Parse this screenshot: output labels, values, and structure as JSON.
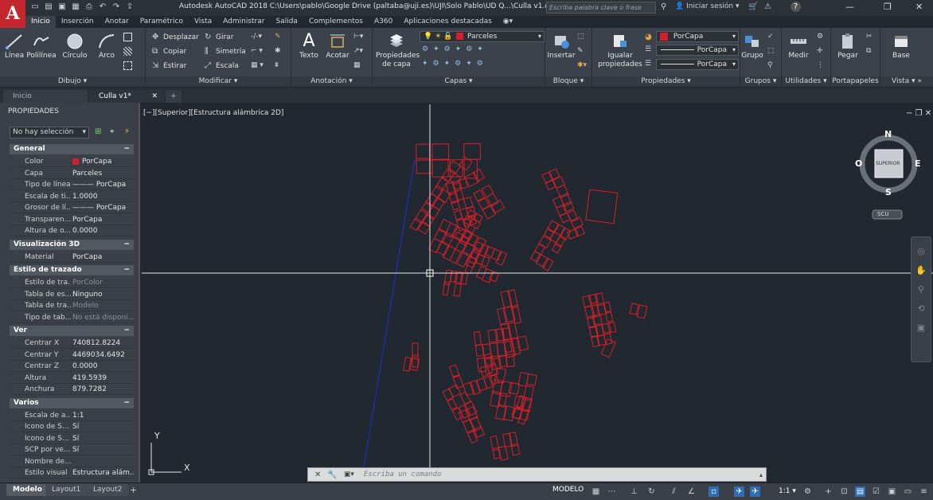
{
  "titlebar": {
    "logo": "A",
    "title": "Autodesk AutoCAD 2018    C:\\Users\\pablo\\Google Drive (paltaba@uji.es)\\UJI\\Solo Pablo\\UD Q...\\Culla v1.dwg",
    "search_placeholder": "Escriba palabra clave o frase",
    "login": "Iniciar sesión"
  },
  "ribbon_tabs": [
    "Inicio",
    "Inserción",
    "Anotar",
    "Paramétrico",
    "Vista",
    "Administrar",
    "Salida",
    "Complementos",
    "A360",
    "Aplicaciones destacadas"
  ],
  "ribbon": {
    "dibujo": {
      "title": "Dibujo",
      "tools": [
        "Línea",
        "Polilínea",
        "Círculo",
        "Arco"
      ]
    },
    "modificar": {
      "title": "Modificar",
      "tools": [
        "Desplazar",
        "Girar",
        "Copiar",
        "Simetría",
        "Estirar",
        "Escala"
      ]
    },
    "anotacion": {
      "title": "Anotación",
      "tools": [
        "Texto",
        "Acotar"
      ]
    },
    "capas": {
      "title": "Capas",
      "props_line1": "Propiedades",
      "props_line2": "de capa",
      "layer": "Parceles"
    },
    "bloque": {
      "title": "Bloque",
      "insert": "Insertar"
    },
    "propiedades": {
      "title": "Propiedades",
      "match_line1": "Igualar",
      "match_line2": "propiedades",
      "color": "PorCapa",
      "linetype": "PorCapa",
      "lineweight": "PorCapa"
    },
    "grupos": {
      "title": "Grupos",
      "group": "Grupo"
    },
    "utilidades": {
      "title": "Utilidades",
      "measure": "Medir"
    },
    "portapapeles": {
      "title": "Portapapeles",
      "paste": "Pegar"
    },
    "vista": {
      "title": "Vista",
      "base": "Base"
    }
  },
  "doc_tabs": [
    "Inicio",
    "Culla v1*"
  ],
  "properties": {
    "header": "PROPIEDADES",
    "selection": "No hay selección",
    "sections": [
      {
        "title": "General",
        "rows": [
          [
            "Color",
            "PorCapa"
          ],
          [
            "Capa",
            "Parceles"
          ],
          [
            "Tipo de línea",
            "——— PorCapa"
          ],
          [
            "Escala de ti...",
            "1.0000"
          ],
          [
            "Grosor de lí...",
            "——— PorCapa"
          ],
          [
            "Transparen...",
            "PorCapa"
          ],
          [
            "Altura de o...",
            "0.0000"
          ]
        ]
      },
      {
        "title": "Visualización 3D",
        "rows": [
          [
            "Material",
            "PorCapa"
          ]
        ]
      },
      {
        "title": "Estilo de trazado",
        "rows": [
          [
            "Estilo de tra...",
            "PorColor"
          ],
          [
            "Tabla de es...",
            "Ninguno"
          ],
          [
            "Tabla de tra...",
            "Modelo"
          ],
          [
            "Tipo de tab...",
            "No está disponi..."
          ]
        ]
      },
      {
        "title": "Ver",
        "rows": [
          [
            "Centrar X",
            "740812.8224"
          ],
          [
            "Centrar Y",
            "4469034.6492"
          ],
          [
            "Centrar Z",
            "0.0000"
          ],
          [
            "Altura",
            "419.5939"
          ],
          [
            "Anchura",
            "879.7282"
          ]
        ]
      },
      {
        "title": "Varios",
        "rows": [
          [
            "Escala de a...",
            "1:1"
          ],
          [
            "Icono de S...",
            "Sí"
          ],
          [
            "Icono de S...",
            "Sí"
          ],
          [
            "SCP por ve...",
            "Sí"
          ],
          [
            "Nombre de...",
            ""
          ],
          [
            "Estilo visual",
            "Estructura alám..."
          ]
        ]
      }
    ]
  },
  "canvas": {
    "viewport_label": "[−][Superior][Estructura alámbrica 2D]",
    "viewcube": {
      "n": "N",
      "s": "S",
      "e": "E",
      "w": "O",
      "face": "SUPERIOR",
      "ucs": "SCU"
    },
    "ucs_x": "X",
    "ucs_y": "Y"
  },
  "command_line": {
    "placeholder": "Escriba un comando"
  },
  "layout_tabs": [
    "Modelo",
    "Layout1",
    "Layout2"
  ],
  "status": {
    "space": "MODELO",
    "scale": "1:1"
  },
  "colors": {
    "parcels": "#d4202a",
    "line": "#1f2fa0",
    "background": "#212830"
  }
}
